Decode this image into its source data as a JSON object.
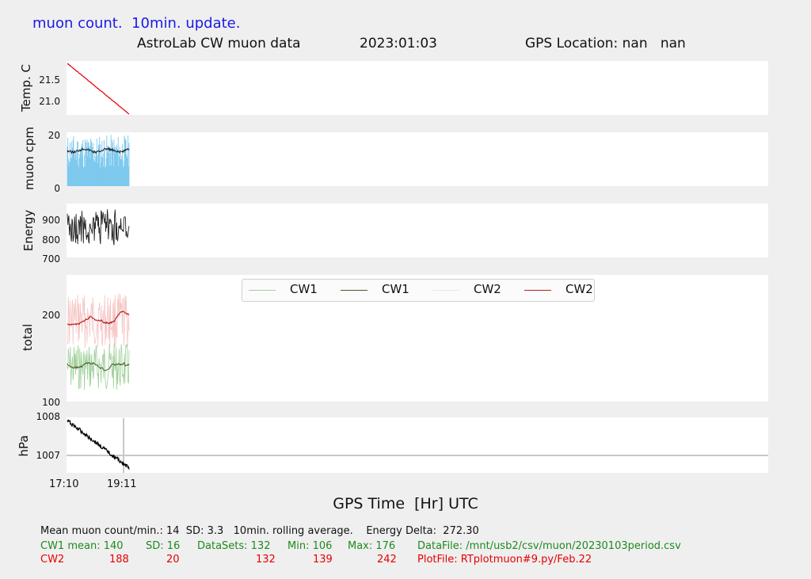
{
  "header": {
    "update_note": "muon count.  10min. update.",
    "title": "AstroLab CW muon data",
    "date": "2023:01:03",
    "gps_location": "GPS Location: nan   nan"
  },
  "colors": {
    "background": "#efefef",
    "panel": "#ffffff",
    "temp_line": "#e60000",
    "muon_bars": "#7cc8ee",
    "muon_avg": "#222222",
    "energy_line": "#222222",
    "cw1_raw": "#9fd09a",
    "cw1_avg": "#4a5a2a",
    "cw2_raw": "#f6c4c4",
    "cw2_avg": "#b02020",
    "pressure_line": "#000000",
    "marker_line": "#c8c8c8"
  },
  "chart_data": [
    {
      "type": "line",
      "ylabel": "Temp. C",
      "yticks": [
        "21.5",
        "21.0"
      ],
      "ylim": [
        20.72,
        21.95
      ],
      "x": [
        "17:10",
        "19:11"
      ],
      "series": [
        {
          "values_start": 21.8,
          "values_end": 20.73
        }
      ]
    },
    {
      "type": "bar",
      "ylabel": "muon cpm",
      "yticks": [
        "20",
        "0"
      ],
      "ylim": [
        0,
        21
      ],
      "mean": 14,
      "sd": 3.3,
      "rolling_average": "10min."
    },
    {
      "type": "line",
      "ylabel": "Energy",
      "yticks": [
        "900",
        "800",
        "700"
      ],
      "ylim": [
        700,
        990
      ],
      "energy_delta": "272.30"
    },
    {
      "type": "line",
      "ylabel": "total",
      "yticks": [
        "200",
        "100"
      ],
      "ylim": [
        100,
        245
      ],
      "series": [
        {
          "name": "CW1",
          "mean": 140,
          "sd": 16,
          "datasets": 132,
          "min": 106,
          "max": 176
        },
        {
          "name": "CW1"
        },
        {
          "name": "CW2",
          "mean": 188,
          "sd": 20,
          "datasets": 132,
          "min": 139,
          "max": 242
        },
        {
          "name": "CW2"
        }
      ]
    },
    {
      "type": "line",
      "ylabel": "hPa",
      "yticks": [
        "1008",
        "1007"
      ],
      "ylim": [
        1006.8,
        1008.0
      ],
      "values_start": 1007.95,
      "values_end": 1006.85,
      "reference_line": 1007
    }
  ],
  "xaxis": {
    "ticks": [
      "17:10",
      "19:11"
    ],
    "label": "GPS Time  [Hr] UTC"
  },
  "legend": [
    "CW1",
    "CW1",
    "CW2",
    "CW2"
  ],
  "stats": {
    "line1": "Mean muon count/min.: 14  SD: 3.3   10min. rolling average.    Energy Delta:  272.30",
    "cw1": {
      "label": "CW1 mean: 140",
      "sd": "SD: 16",
      "datasets": "DataSets: 132",
      "min": "Min: 106",
      "max": "Max: 176",
      "file": "DataFile: /mnt/usb2/csv/muon/20230103period.csv"
    },
    "cw2": {
      "label": "CW2",
      "mean": "188",
      "sd": "20",
      "datasets": "132",
      "min": "139",
      "max": "242",
      "file": "PlotFile: RTplotmuon#9.py/Feb.22"
    }
  }
}
